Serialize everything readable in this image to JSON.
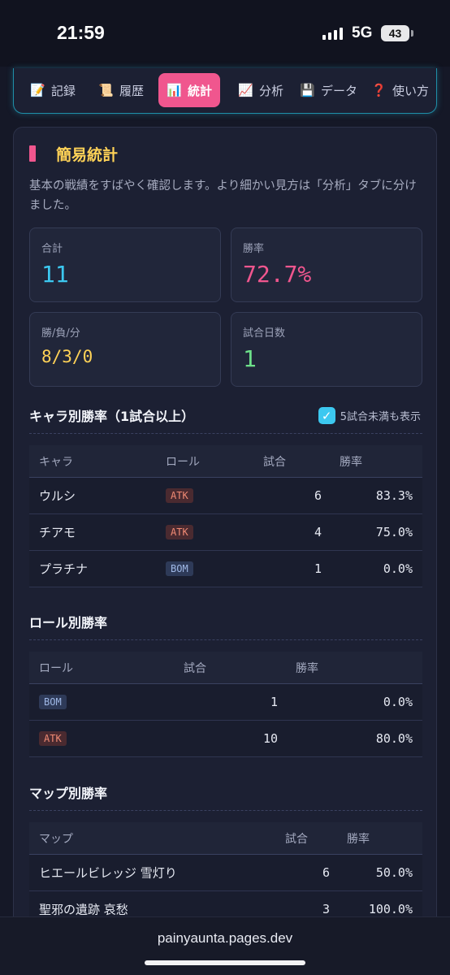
{
  "status": {
    "time": "21:59",
    "network": "5G",
    "battery": "43"
  },
  "nav": {
    "tabs": [
      {
        "icon": "📝",
        "label": "記録"
      },
      {
        "icon": "📜",
        "label": "履歴"
      },
      {
        "icon": "📊",
        "label": "統計"
      },
      {
        "icon": "📈",
        "label": "分析"
      },
      {
        "icon": "💾",
        "label": "データ"
      },
      {
        "icon": "❓",
        "label": "使い方"
      }
    ],
    "active": "統計"
  },
  "panel": {
    "title": "簡易統計",
    "description": "基本の戦績をすばやく確認します。より細かい見方は「分析」タブに分けました。"
  },
  "stats": {
    "total": {
      "label": "合計",
      "value": "11"
    },
    "winrate": {
      "label": "勝率",
      "value": "72.7%"
    },
    "wld": {
      "label": "勝/負/分",
      "value": "8/3/0"
    },
    "days": {
      "label": "試合日数",
      "value": "1"
    }
  },
  "colors": {
    "accent_pink": "#f0568e",
    "accent_cyan": "#3cc8f0",
    "accent_yellow": "#ffd257",
    "accent_green": "#6de08a"
  },
  "by_character": {
    "title": "キャラ別勝率（1試合以上）",
    "checkbox_label": "5試合未満も表示",
    "checkbox_checked": true,
    "headers": [
      "キャラ",
      "ロール",
      "試合",
      "勝率"
    ],
    "rows": [
      {
        "name": "ウルシ",
        "role": "ATK",
        "matches": "6",
        "winrate": "83.3%"
      },
      {
        "name": "チアモ",
        "role": "ATK",
        "matches": "4",
        "winrate": "75.0%"
      },
      {
        "name": "プラチナ",
        "role": "BOM",
        "matches": "1",
        "winrate": "0.0%"
      }
    ]
  },
  "by_role": {
    "title": "ロール別勝率",
    "headers": [
      "ロール",
      "試合",
      "勝率"
    ],
    "rows": [
      {
        "role": "BOM",
        "matches": "1",
        "winrate": "0.0%"
      },
      {
        "role": "ATK",
        "matches": "10",
        "winrate": "80.0%"
      }
    ]
  },
  "by_map": {
    "title": "マップ別勝率",
    "headers": [
      "マップ",
      "試合",
      "勝率"
    ],
    "rows": [
      {
        "map": "ヒエールビレッジ 雪灯り",
        "matches": "6",
        "winrate": "50.0%"
      },
      {
        "map": "聖邪の遺跡 哀愁",
        "matches": "3",
        "winrate": "100.0%"
      }
    ]
  },
  "browser": {
    "url": "painyaunta.pages.dev"
  }
}
